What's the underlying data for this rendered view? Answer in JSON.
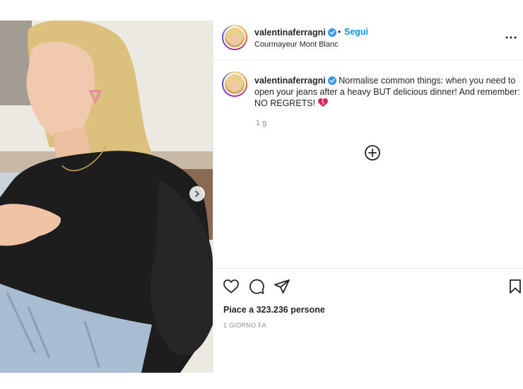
{
  "post": {
    "username": "valentinaferragni",
    "follow_label": "Segui",
    "separator": "•",
    "location": "Courmayeur Mont Blanc",
    "caption_text": "Normalise common things: when you need to open your jeans after a heavy BUT delicious dinner! And remember: NO REGRETS! ",
    "caption_emoji": "broken-heart",
    "age": "1 g",
    "likes": "Piace a 323.236 persone",
    "date": "1 GIORNO FA",
    "icons": {
      "verified": "verified-badge-icon",
      "more": "more-options-icon",
      "next": "chevron-right-icon",
      "load_more": "plus-circle-icon",
      "like": "heart-icon",
      "comment": "comment-icon",
      "share": "paper-plane-icon",
      "save": "bookmark-icon"
    },
    "colors": {
      "accent": "#0095f6",
      "verified": "#3897f0",
      "emoji": "#e0245e"
    }
  }
}
